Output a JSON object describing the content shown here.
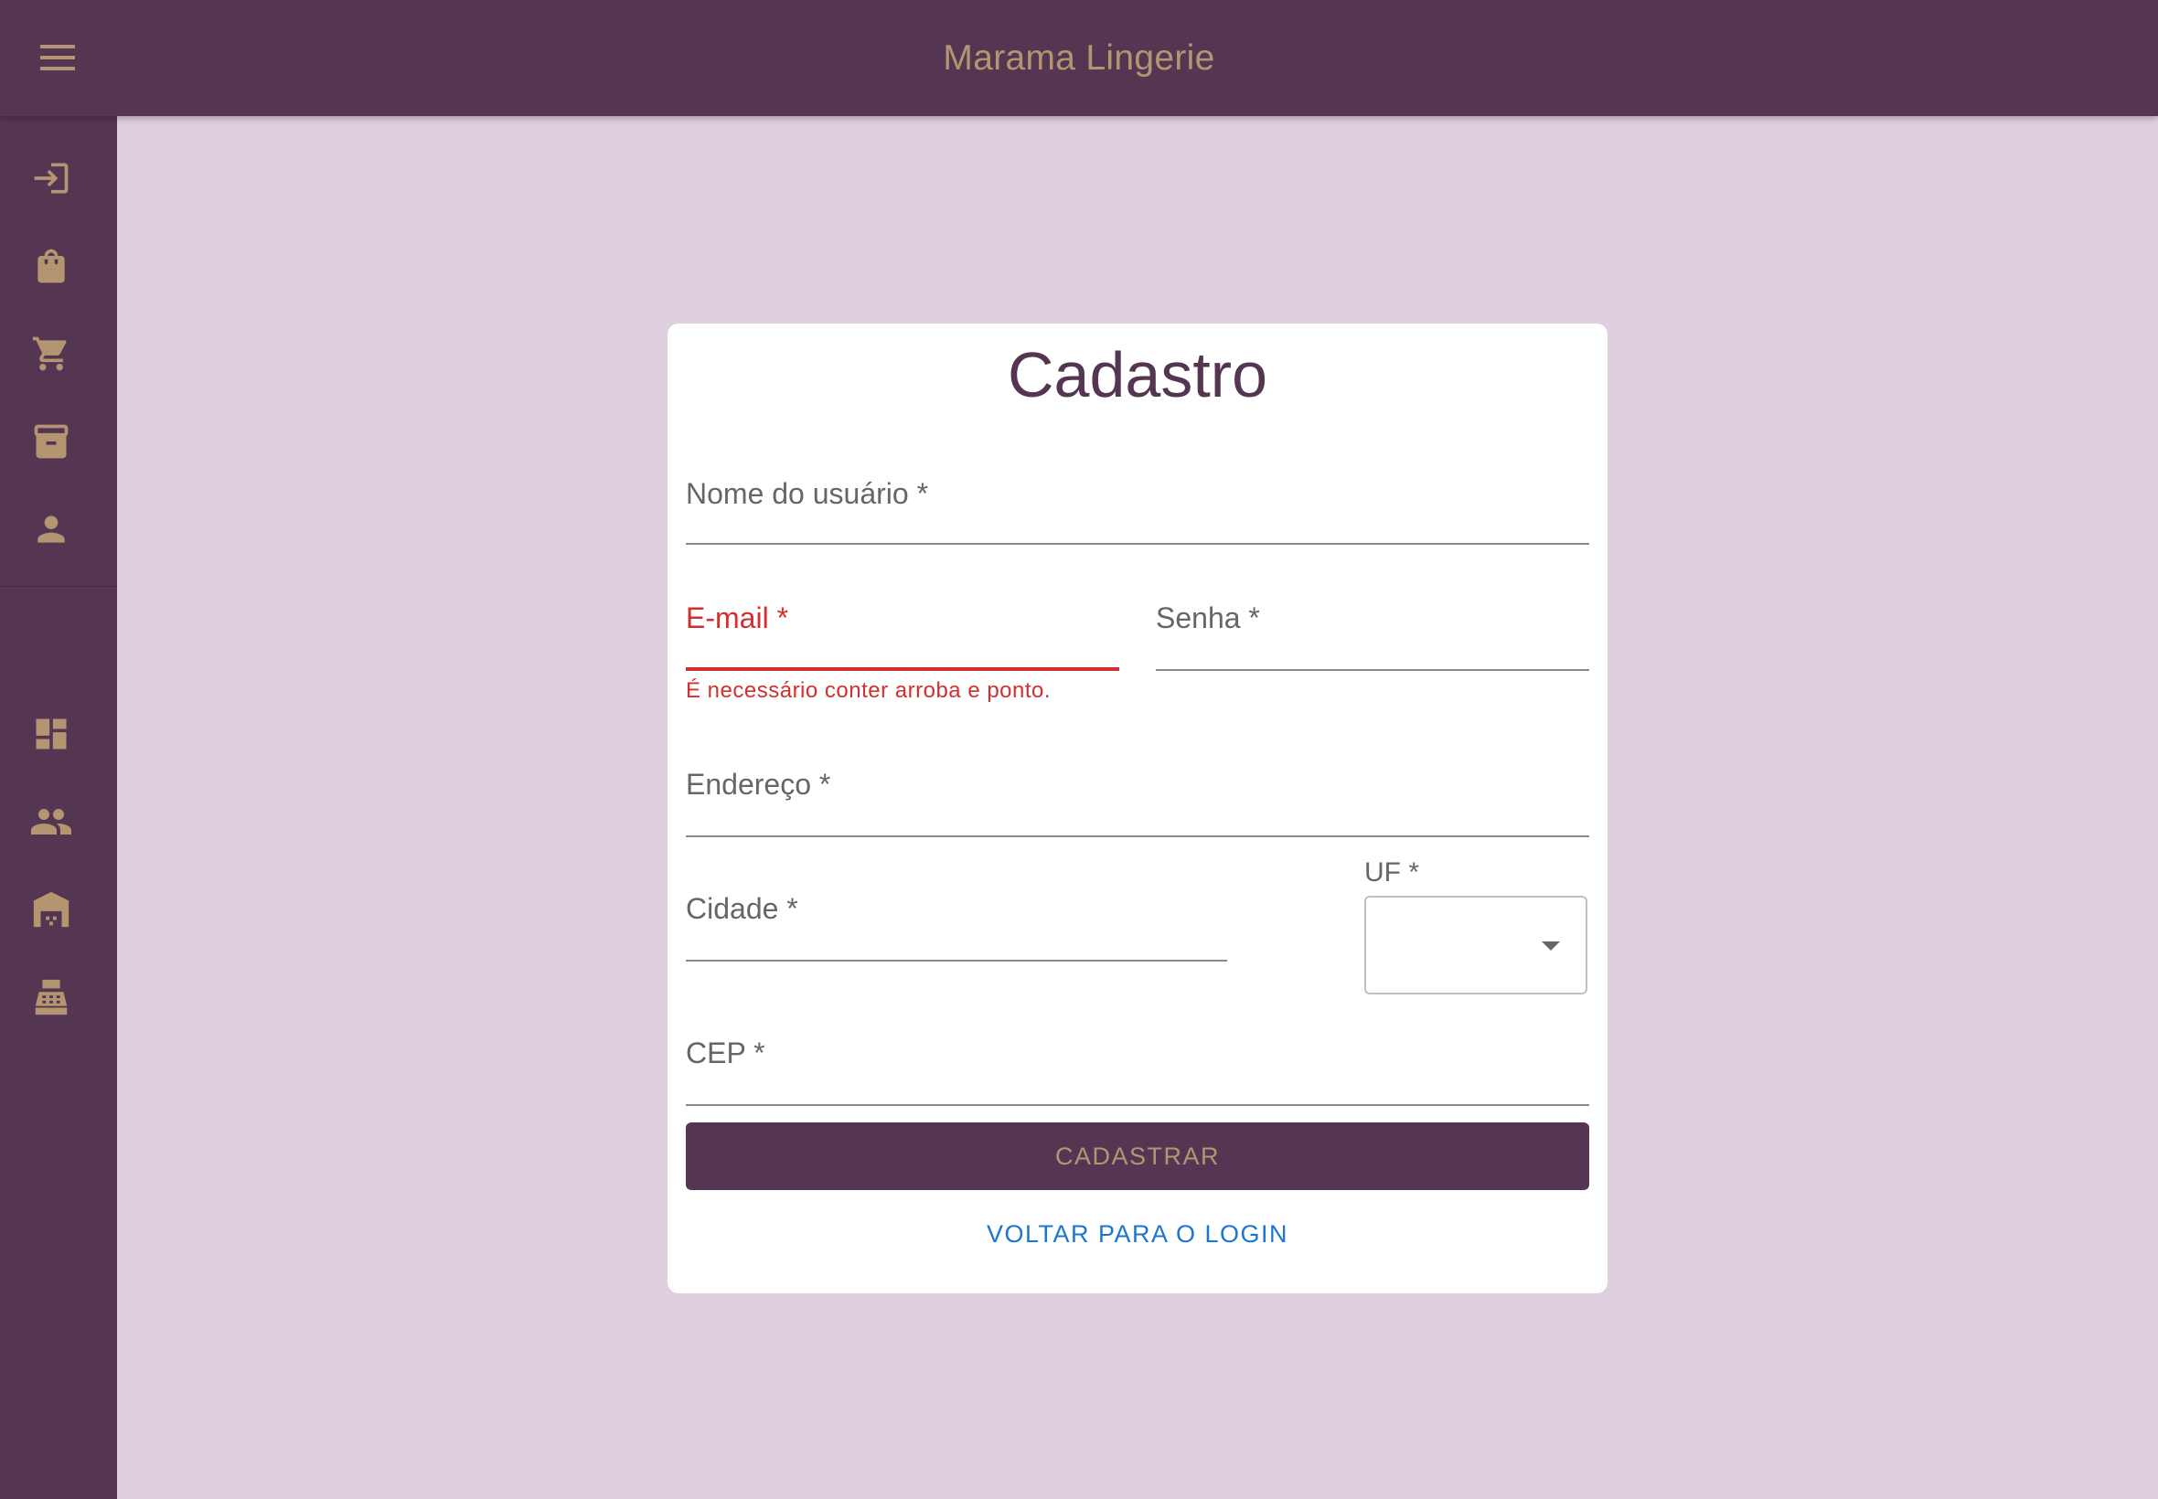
{
  "header": {
    "title": "Marama Lingerie",
    "menu_icon": "menu-icon"
  },
  "sidebar": {
    "items": [
      {
        "icon": "login-icon"
      },
      {
        "icon": "shopping-bag-icon"
      },
      {
        "icon": "shopping-cart-icon"
      },
      {
        "icon": "archive-icon"
      },
      {
        "icon": "person-icon"
      },
      {
        "icon": "dashboard-icon"
      },
      {
        "icon": "people-icon"
      },
      {
        "icon": "warehouse-icon"
      },
      {
        "icon": "cash-register-icon"
      }
    ]
  },
  "form": {
    "title": "Cadastro",
    "username_label": "Nome do usuário *",
    "email_label": "E-mail *",
    "email_error": "É necessário conter arroba e ponto.",
    "password_label": "Senha *",
    "address_label": "Endereço *",
    "city_label": "Cidade *",
    "uf_label": "UF *",
    "uf_value": "",
    "cep_label": "CEP *",
    "submit_label": "CADASTRAR",
    "back_label": "VOLTAR PARA O LOGIN"
  },
  "colors": {
    "primary": "#543652",
    "accent": "#b49571",
    "background": "#dfcfdf",
    "error": "#d32f2f",
    "link": "#1976d2"
  }
}
